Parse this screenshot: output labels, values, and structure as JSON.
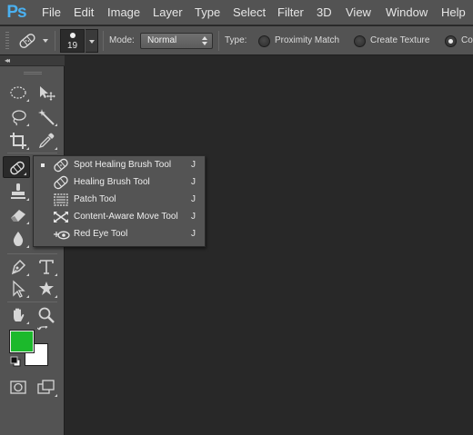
{
  "app": {
    "logo_text": "Ps",
    "accent_color": "#4ab0f0"
  },
  "menu": {
    "items": [
      {
        "label": "File"
      },
      {
        "label": "Edit"
      },
      {
        "label": "Image"
      },
      {
        "label": "Layer"
      },
      {
        "label": "Type"
      },
      {
        "label": "Select"
      },
      {
        "label": "Filter"
      },
      {
        "label": "3D"
      },
      {
        "label": "View"
      },
      {
        "label": "Window"
      },
      {
        "label": "Help"
      }
    ]
  },
  "options": {
    "tool_preset_icon": "spot-healing-brush-icon",
    "brush_size": "19",
    "mode_label": "Mode:",
    "mode_value": "Normal",
    "type_label": "Type:",
    "type_options": [
      {
        "label": "Proximity Match",
        "checked": false
      },
      {
        "label": "Create Texture",
        "checked": false
      },
      {
        "label": "Content-Aware",
        "checked": true
      }
    ]
  },
  "tools": {
    "items": [
      {
        "icon": "elliptical-marquee-icon"
      },
      {
        "icon": "move-icon"
      },
      {
        "icon": "lasso-icon"
      },
      {
        "icon": "magic-wand-icon"
      },
      {
        "icon": "crop-icon"
      },
      {
        "icon": "eyedropper-icon"
      },
      {
        "icon": "spot-healing-brush-icon",
        "active": true
      },
      {
        "icon": "brush-icon"
      },
      {
        "icon": "clone-stamp-icon"
      },
      {
        "icon": "history-brush-icon"
      },
      {
        "icon": "eraser-icon"
      },
      {
        "icon": "gradient-icon"
      },
      {
        "icon": "blur-icon"
      },
      {
        "icon": "dodge-icon"
      },
      {
        "icon": "pen-icon"
      },
      {
        "icon": "type-icon"
      },
      {
        "icon": "path-selection-icon"
      },
      {
        "icon": "custom-shape-icon"
      },
      {
        "icon": "hand-icon"
      },
      {
        "icon": "zoom-icon"
      },
      {
        "icon": "quick-mask-icon"
      },
      {
        "icon": "screen-mode-icon"
      }
    ],
    "foreground_color": "#1cb92c",
    "background_color": "#ffffff"
  },
  "flyout": {
    "items": [
      {
        "label": "Spot Healing Brush Tool",
        "shortcut": "J",
        "icon": "spot-healing-brush-icon",
        "selected": true
      },
      {
        "label": "Healing Brush Tool",
        "shortcut": "J",
        "icon": "healing-brush-icon",
        "selected": false
      },
      {
        "label": "Patch Tool",
        "shortcut": "J",
        "icon": "patch-icon",
        "selected": false
      },
      {
        "label": "Content-Aware Move Tool",
        "shortcut": "J",
        "icon": "content-aware-move-icon",
        "selected": false
      },
      {
        "label": "Red Eye Tool",
        "shortcut": "J",
        "icon": "red-eye-icon",
        "selected": false
      }
    ]
  }
}
